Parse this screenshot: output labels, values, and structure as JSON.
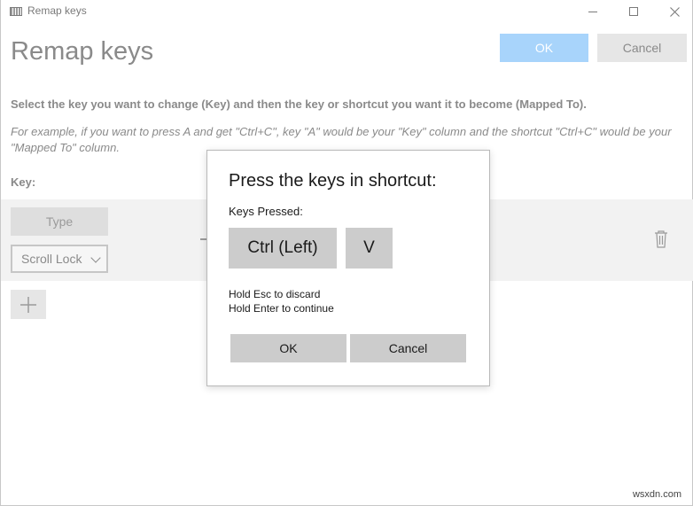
{
  "window": {
    "title": "Remap keys"
  },
  "header": {
    "title": "Remap keys",
    "ok_label": "OK",
    "cancel_label": "Cancel"
  },
  "instructions": {
    "main": "Select the key you want to change (Key) and then the key or shortcut you want it to become (Mapped To).",
    "example": "For example, if you want to press A and get \"Ctrl+C\", key \"A\" would be your \"Key\" column and the shortcut \"Ctrl+C\" would be your \"Mapped To\" column."
  },
  "columns": {
    "key_label": "Key:"
  },
  "mapping_row": {
    "type_button": "Type",
    "selected_key": "Scroll Lock"
  },
  "dialog": {
    "title": "Press the keys in shortcut:",
    "subtitle": "Keys Pressed:",
    "keys": [
      "Ctrl (Left)",
      "V"
    ],
    "hint_discard": "Hold Esc to discard",
    "hint_continue": "Hold Enter to continue",
    "ok_label": "OK",
    "cancel_label": "Cancel"
  },
  "watermark": "wsxdn.com",
  "colors": {
    "accent_disabled": "#a8d4fb",
    "dialog_button": "#cccccc",
    "row_background": "#f2f2f2"
  }
}
